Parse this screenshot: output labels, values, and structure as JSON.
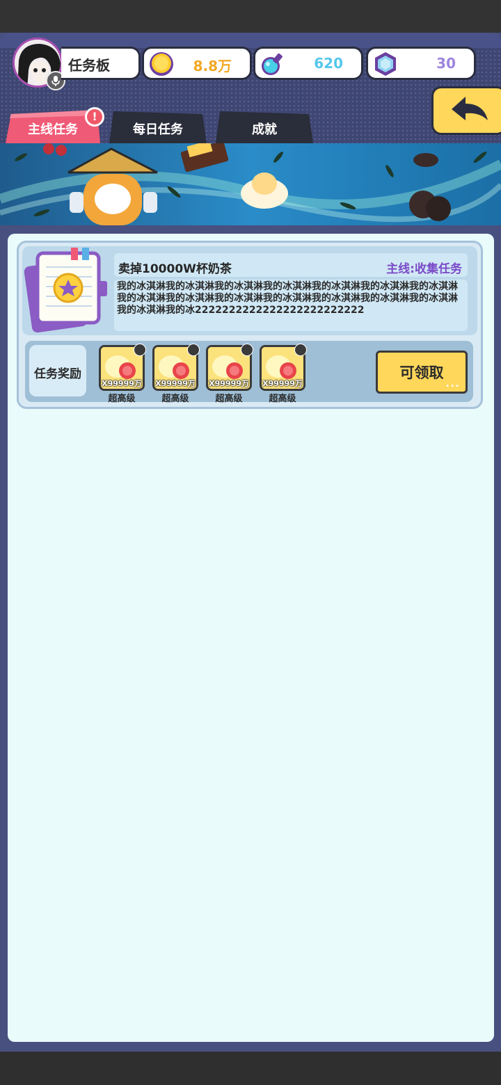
{
  "header": {
    "title": "任务板",
    "resources": [
      {
        "name": "gold-coin",
        "value": "8.8万",
        "color": "#f2a823"
      },
      {
        "name": "potion",
        "value": "620",
        "color": "#55c7ec"
      },
      {
        "name": "gem",
        "value": "30",
        "color": "#9d84e0"
      }
    ]
  },
  "tabs": [
    {
      "label": "主线任务",
      "active": true,
      "alert": "!"
    },
    {
      "label": "每日任务",
      "active": false
    },
    {
      "label": "成就",
      "active": false
    }
  ],
  "task": {
    "title": "卖掉10000W杯奶茶",
    "type": "主线:收集任务",
    "description": "我的冰淇淋我的冰淇淋我的冰淇淋我的冰淇淋我的冰淇淋我的冰淇淋我的冰淇淋我的冰淇淋我的冰淇淋我的冰淇淋我的冰淇淋我的冰淇淋我的冰淇淋我的冰淇淋我的冰淇淋我的冰2222222222222222222222222",
    "reward_label": "任务奖励",
    "rewards": [
      {
        "qty": "X99999万",
        "name": "超高级"
      },
      {
        "qty": "X99999万",
        "name": "超高级"
      },
      {
        "qty": "X99999万",
        "name": "超高级"
      },
      {
        "qty": "X99999万",
        "name": "超高级"
      }
    ],
    "claim_label": "可领取"
  }
}
